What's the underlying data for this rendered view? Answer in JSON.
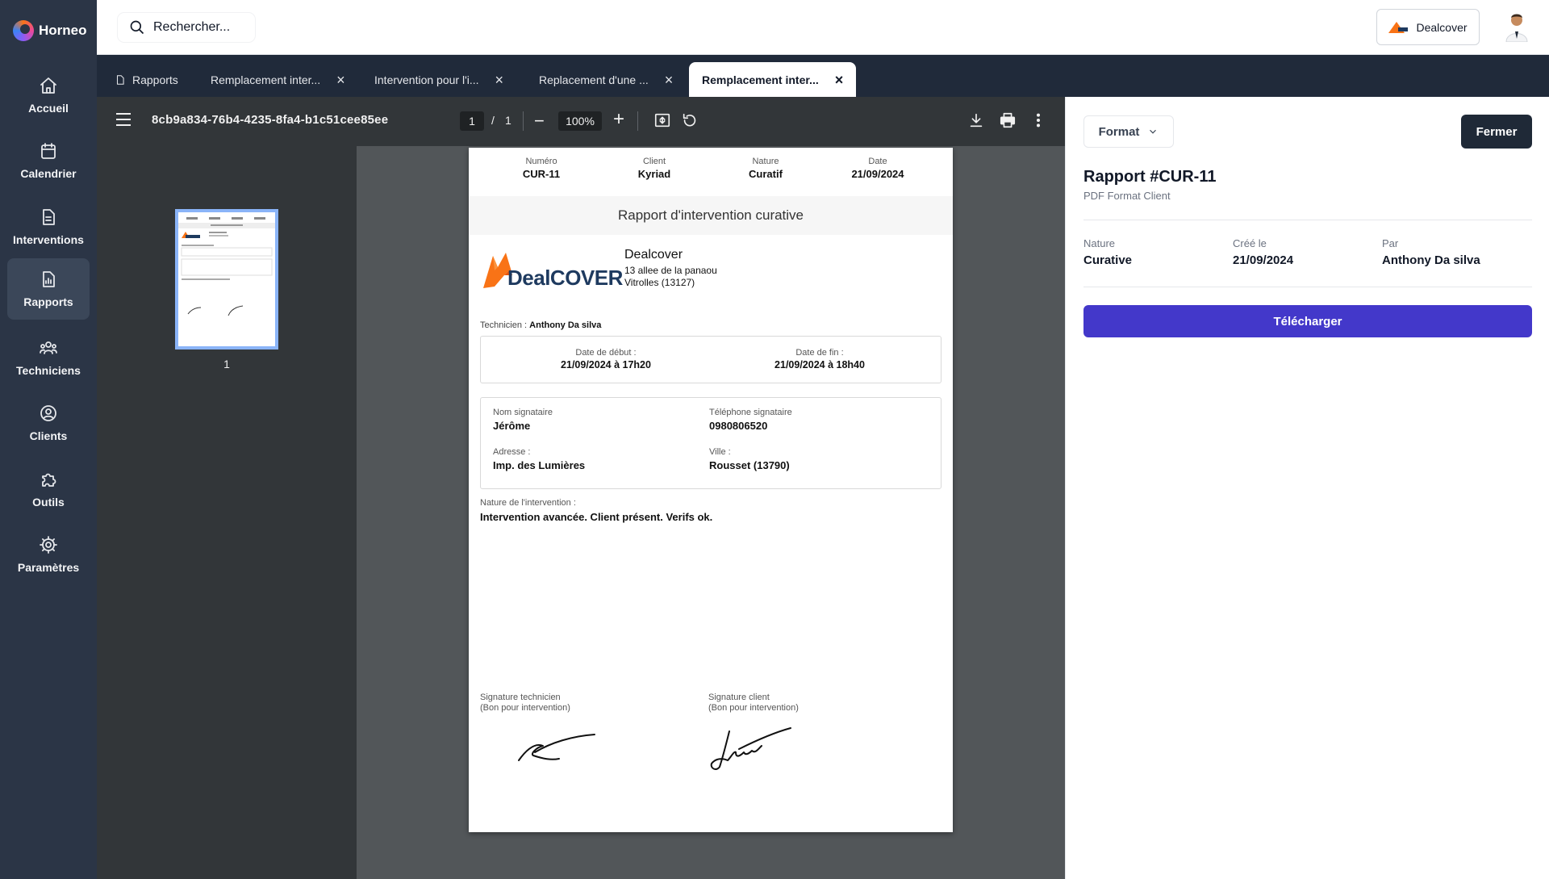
{
  "app": {
    "name": "Horneo"
  },
  "sidebar": {
    "items": [
      {
        "label": "Accueil",
        "icon": "home-icon"
      },
      {
        "label": "Calendrier",
        "icon": "calendar-icon"
      },
      {
        "label": "Interventions",
        "icon": "document-icon"
      },
      {
        "label": "Rapports",
        "icon": "report-icon",
        "active": true
      },
      {
        "label": "Techniciens",
        "icon": "team-icon"
      },
      {
        "label": "Clients",
        "icon": "user-circle-icon"
      },
      {
        "label": "Outils",
        "icon": "puzzle-icon"
      },
      {
        "label": "Paramètres",
        "icon": "gear-icon"
      }
    ]
  },
  "topbar": {
    "search_placeholder": "Rechercher...",
    "company_label": "Dealcover"
  },
  "tabs": [
    {
      "label": "Rapports",
      "closable": false
    },
    {
      "label": "Remplacement inter...",
      "closable": true
    },
    {
      "label": "Intervention pour l'i...",
      "closable": true
    },
    {
      "label": "Replacement d'une ...",
      "closable": true
    },
    {
      "label": "Remplacement inter...",
      "closable": true,
      "active": true
    }
  ],
  "viewer": {
    "file_name": "8cb9a834-76b4-4235-8fa4-b1c51cee85ee",
    "current_page": "1",
    "page_separator": "/",
    "total_pages": "1",
    "zoom": "100%",
    "thumbnail_label": "1"
  },
  "pdf": {
    "header": [
      {
        "label": "Numéro",
        "value": "CUR-11"
      },
      {
        "label": "Client",
        "value": "Kyriad"
      },
      {
        "label": "Nature",
        "value": "Curatif"
      },
      {
        "label": "Date",
        "value": "21/09/2024"
      }
    ],
    "title": "Rapport d'intervention curative",
    "logo_text": "DealCOVER",
    "company": {
      "name": "Dealcover",
      "address_line1": "13 allee de la panaou",
      "address_line2": "Vitrolles (13127)"
    },
    "technician_label": "Technicien :",
    "technician_name": "Anthony Da silva",
    "start_label": "Date de début :",
    "start_value": "21/09/2024 à 17h20",
    "end_label": "Date de fin :",
    "end_value": "21/09/2024 à 18h40",
    "signer_name_label": "Nom signataire",
    "signer_name": "Jérôme",
    "signer_phone_label": "Téléphone signataire",
    "signer_phone": "0980806520",
    "address_label": "Adresse :",
    "address_value": "Imp. des Lumières",
    "city_label": "Ville :",
    "city_value": "Rousset (13790)",
    "nature_label": "Nature de l'intervention :",
    "nature_value": "Intervention avancée. Client présent. Verifs ok.",
    "sig_tech_label1": "Signature technicien",
    "sig_tech_label2": "(Bon pour intervention)",
    "sig_client_label1": "Signature client",
    "sig_client_label2": "(Bon pour intervention)"
  },
  "panel": {
    "format_label": "Format",
    "close_label": "Fermer",
    "title": "Rapport #CUR-11",
    "subtitle": "PDF Format Client",
    "fields": [
      {
        "label": "Nature",
        "value": "Curative"
      },
      {
        "label": "Créé le",
        "value": "21/09/2024"
      },
      {
        "label": "Par",
        "value": "Anthony Da silva"
      }
    ],
    "download_label": "Télécharger"
  },
  "colors": {
    "sidebar_bg": "#2b3546",
    "tabbar_bg": "#202a3a",
    "primary_button": "#4338ca",
    "close_button": "#1f2937",
    "logo_orange": "#f97316",
    "logo_navy": "#1e3a5f"
  }
}
